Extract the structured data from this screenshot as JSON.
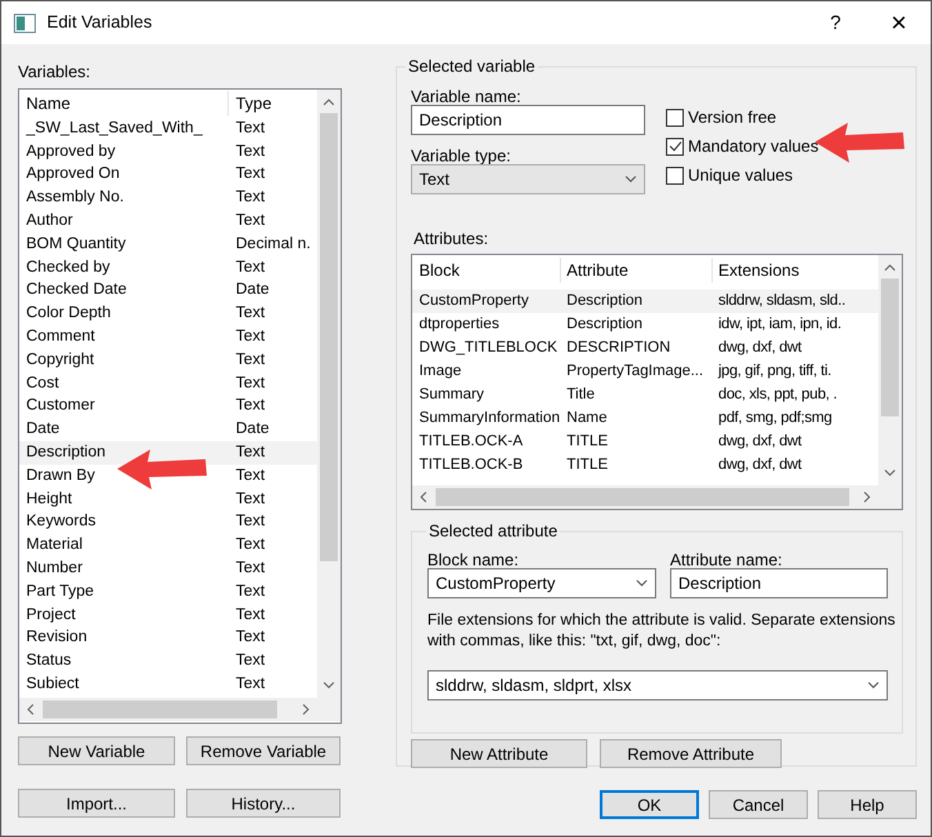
{
  "window": {
    "title": "Edit Variables",
    "buttons": [
      "?",
      "×"
    ]
  },
  "variables": {
    "label": "Variables:",
    "columns": [
      "Name",
      "Type"
    ],
    "rows": [
      {
        "name": "_SW_Last_Saved_With_",
        "type": "Text",
        "selected": false
      },
      {
        "name": "Approved by",
        "type": "Text",
        "selected": false
      },
      {
        "name": "Approved On",
        "type": "Text",
        "selected": false
      },
      {
        "name": "Assembly No.",
        "type": "Text",
        "selected": false
      },
      {
        "name": "Author",
        "type": "Text",
        "selected": false
      },
      {
        "name": "BOM Quantity",
        "type": "Decimal n.",
        "selected": false
      },
      {
        "name": "Checked by",
        "type": "Text",
        "selected": false
      },
      {
        "name": "Checked Date",
        "type": "Date",
        "selected": false
      },
      {
        "name": "Color Depth",
        "type": "Text",
        "selected": false
      },
      {
        "name": "Comment",
        "type": "Text",
        "selected": false
      },
      {
        "name": "Copyright",
        "type": "Text",
        "selected": false
      },
      {
        "name": "Cost",
        "type": "Text",
        "selected": false
      },
      {
        "name": "Customer",
        "type": "Text",
        "selected": false
      },
      {
        "name": "Date",
        "type": "Date",
        "selected": false
      },
      {
        "name": "Description",
        "type": "Text",
        "selected": true
      },
      {
        "name": "Drawn By",
        "type": "Text",
        "selected": false
      },
      {
        "name": "Height",
        "type": "Text",
        "selected": false
      },
      {
        "name": "Keywords",
        "type": "Text",
        "selected": false
      },
      {
        "name": "Material",
        "type": "Text",
        "selected": false
      },
      {
        "name": "Number",
        "type": "Text",
        "selected": false
      },
      {
        "name": "Part Type",
        "type": "Text",
        "selected": false
      },
      {
        "name": "Project",
        "type": "Text",
        "selected": false
      },
      {
        "name": "Revision",
        "type": "Text",
        "selected": false
      },
      {
        "name": "Status",
        "type": "Text",
        "selected": false
      },
      {
        "name": "Subiect",
        "type": "Text",
        "selected": false
      }
    ],
    "buttons": [
      "New Variable",
      "Remove Variable",
      "Import...",
      "History..."
    ]
  },
  "selected_variable": {
    "title": "Selected variable",
    "name_label": "Variable name:",
    "name_value": "Description",
    "type_label": "Variable type:",
    "type_value": "Text",
    "options": [
      {
        "label": "Version free",
        "checked": false
      },
      {
        "label": "Mandatory values",
        "checked": true
      },
      {
        "label": "Unique values",
        "checked": false
      }
    ],
    "attributes_label": "Attributes:",
    "columns": [
      "Block",
      "Attribute",
      "Extensions"
    ],
    "rows": [
      {
        "block": "CustomProperty",
        "attribute": "Description",
        "extensions": "slddrw, sldasm, sld..",
        "selected": true
      },
      {
        "block": "dtproperties",
        "attribute": "Description",
        "extensions": "idw, ipt, iam, ipn, id.",
        "selected": false
      },
      {
        "block": "DWG_TITLEBLOCK",
        "attribute": "DESCRIPTION",
        "extensions": "dwg, dxf, dwt",
        "selected": false
      },
      {
        "block": "Image",
        "attribute": "PropertyTagImage...",
        "extensions": "jpg, gif, png, tiff, ti.",
        "selected": false
      },
      {
        "block": "Summary",
        "attribute": "Title",
        "extensions": "doc, xls, ppt, pub, .",
        "selected": false
      },
      {
        "block": "SummaryInformation",
        "attribute": "Name",
        "extensions": "pdf, smg, pdf;smg",
        "selected": false
      },
      {
        "block": "TITLEB.OCK-A",
        "attribute": "TITLE",
        "extensions": "dwg, dxf, dwt",
        "selected": false
      },
      {
        "block": "TITLEB.OCK-B",
        "attribute": "TITLE",
        "extensions": "dwg, dxf, dwt",
        "selected": false
      }
    ],
    "buttons": [
      "New Attribute",
      "Remove Attribute"
    ]
  },
  "selected_attribute": {
    "title": "Selected attribute",
    "block_label": "Block name:",
    "block_value": "CustomProperty",
    "attr_label": "Attribute name:",
    "attr_value": "Description",
    "hint": "File extensions for which the attribute is valid. Separate extensions with commas, like this: \"txt, gif, dwg, doc\":",
    "extensions_value": "slddrw, sldasm, sldprt, xlsx"
  },
  "footer": {
    "buttons": [
      {
        "label": "OK",
        "selected": true
      },
      {
        "label": "Cancel",
        "selected": false
      },
      {
        "label": "Help",
        "selected": false
      }
    ]
  }
}
